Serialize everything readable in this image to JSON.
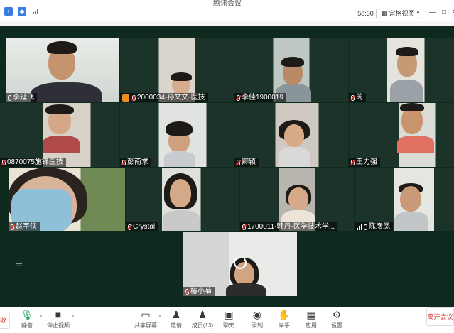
{
  "titlebar": {
    "title": "腾讯会议",
    "timer": "58:30",
    "gallery_label": "宫格视图",
    "icons": [
      "info-icon",
      "shield-icon",
      "signal-icon"
    ],
    "window_controls": [
      "minimize-icon",
      "restore-icon",
      "close-icon"
    ]
  },
  "participants": [
    {
      "name": "李延飞",
      "mic": "on",
      "speaking": true
    },
    {
      "name": "2000034-孙文文-医技",
      "mic": "muted",
      "badge": "host-badge"
    },
    {
      "name": "李佳1900019",
      "mic": "muted"
    },
    {
      "name": "芮",
      "mic": "muted"
    },
    {
      "name": "0870075施锦医技",
      "mic": "muted"
    },
    {
      "name": "彭南求",
      "mic": "muted"
    },
    {
      "name": "卿颖",
      "mic": "muted"
    },
    {
      "name": "王力强",
      "mic": "muted"
    },
    {
      "name": "赵宇侠",
      "mic": "muted"
    },
    {
      "name": "Crystal",
      "mic": "muted"
    },
    {
      "name": "1700011-韩丹-医学技术学...",
      "mic": "muted"
    },
    {
      "name": "陈彦凤",
      "mic": "speaking"
    },
    {
      "name": "椿小菊",
      "mic": "muted"
    }
  ],
  "toolbar": {
    "left_cut": "收",
    "items": [
      {
        "label": "静音",
        "icon": "microphone-icon"
      },
      {
        "label": "停止视频",
        "icon": "video-camera-icon"
      },
      {
        "label": "共享屏幕",
        "icon": "share-screen-icon"
      },
      {
        "label": "邀请",
        "icon": "invite-icon"
      },
      {
        "label": "成员(13)",
        "icon": "members-icon"
      },
      {
        "label": "聊天",
        "icon": "chat-icon"
      },
      {
        "label": "录制",
        "icon": "record-icon"
      },
      {
        "label": "举手",
        "icon": "raise-hand-icon"
      },
      {
        "label": "应用",
        "icon": "apps-icon"
      },
      {
        "label": "设置",
        "icon": "settings-icon"
      }
    ],
    "leave_label": "离开会议"
  },
  "colors": {
    "stage_bg": "#0e2a1f",
    "speaking_border": "#3cd074",
    "leave_red": "#d9352f",
    "host_badge": "#f08c1e"
  }
}
